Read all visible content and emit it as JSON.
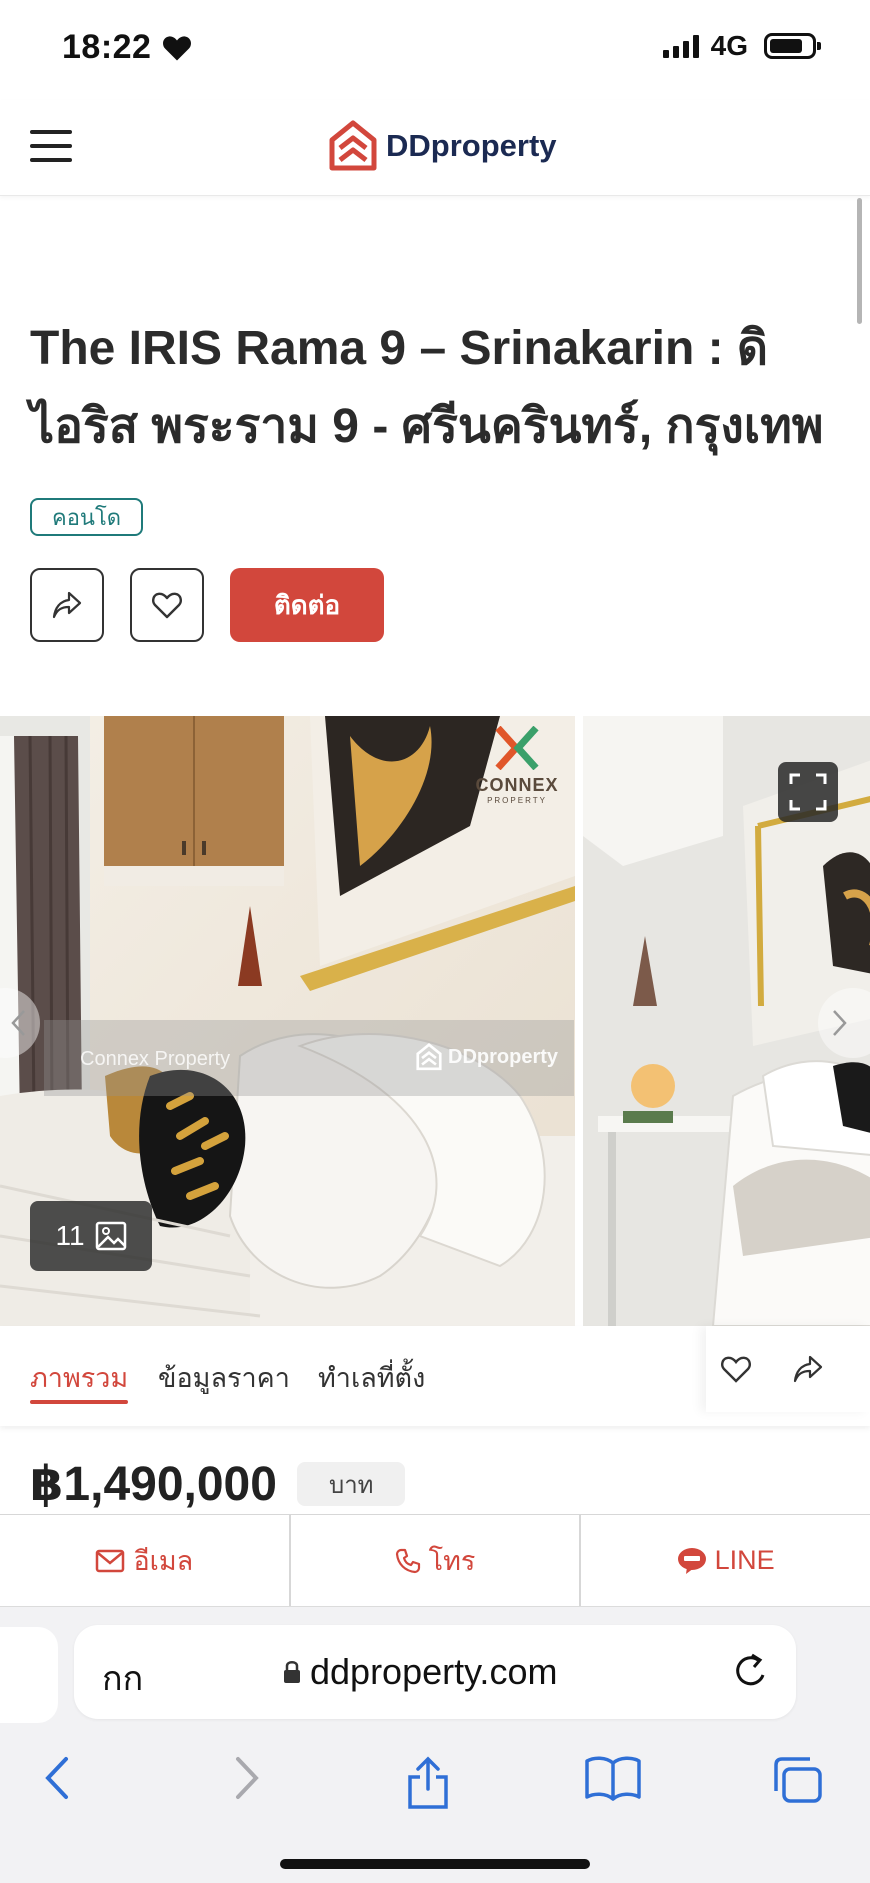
{
  "status_bar": {
    "time": "18:22",
    "network": "4G"
  },
  "header": {
    "logo_text": "DDproperty",
    "menu_icon": "hamburger-icon",
    "brand_color": "#d2473c"
  },
  "listing": {
    "title": "The IRIS Rama 9 – Srinakarin : ดิ ไอริส พระราม 9 - ศรีนครินทร์, กรุงเทพ",
    "type_tag": "คอนโด",
    "contact_label": "ติดต่อ"
  },
  "gallery": {
    "photo_count": "11",
    "watermark_agent": "Connex Property",
    "watermark_brand": "DDproperty",
    "logo_name": "CONNEX",
    "logo_sub": "PROPERTY"
  },
  "tabs": [
    {
      "label": "ภาพรวม",
      "active": true
    },
    {
      "label": "ข้อมูลราคา",
      "active": false
    },
    {
      "label": "ทำเลที่ตั้ง",
      "active": false
    }
  ],
  "price": {
    "currency": "฿",
    "amount": "1,490,000",
    "unit": "บาท"
  },
  "contact_bar": {
    "email": "อีเมล",
    "phone": "โทร",
    "line": "LINE"
  },
  "browser": {
    "aa_label": "กก",
    "url": "ddproperty.com"
  }
}
